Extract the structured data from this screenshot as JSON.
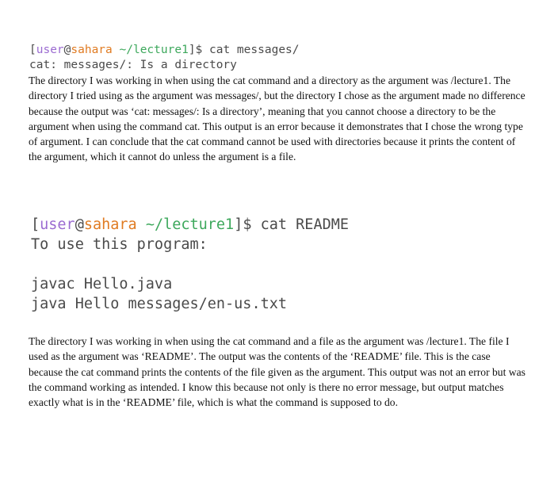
{
  "terminal1": {
    "user": "user",
    "at": "@",
    "host": "sahara",
    "path": "~/lecture1",
    "suffix": "]$ cat messages/",
    "bracket": "[",
    "output": "cat: messages/: Is a directory"
  },
  "paragraph1": "The directory I was working in when using the cat command and a directory as the argument was /lecture1. The directory I tried using as the argument was messages/, but the directory I chose as the argument made no difference because the output was ‘cat: messages/: Is a directory’, meaning that you cannot choose a directory to be the argument when using the command cat. This output is an error because it demonstrates that I chose the wrong type of argument. I can conclude that the cat command cannot be used with directories because it prints the content of the argument, which it cannot do unless the argument is a file.",
  "terminal2": {
    "bracket": "[",
    "user": "user",
    "at": "@",
    "host": "sahara",
    "path": "~/lecture1",
    "suffix": "]$ cat README",
    "output_lines": [
      "To use this program:",
      "javac Hello.java",
      "java Hello messages/en-us.txt"
    ]
  },
  "paragraph2": "The directory I was working in when using the cat command and a file as the argument was /lecture1. The file I used as the argument was ‘README’. The output was the contents of the ‘README’ file. This is the case because the cat command prints the contents of the file given as the argument. This output was not an error but was the command working as intended. I know this because not only is there no error message, but output matches exactly what is in the ‘README’ file, which is what the command is supposed to do.",
  "colors": {
    "user": "#9b6bd1",
    "host": "#e07b22",
    "path": "#3da85c",
    "terminal_text": "#4a4a4a"
  }
}
